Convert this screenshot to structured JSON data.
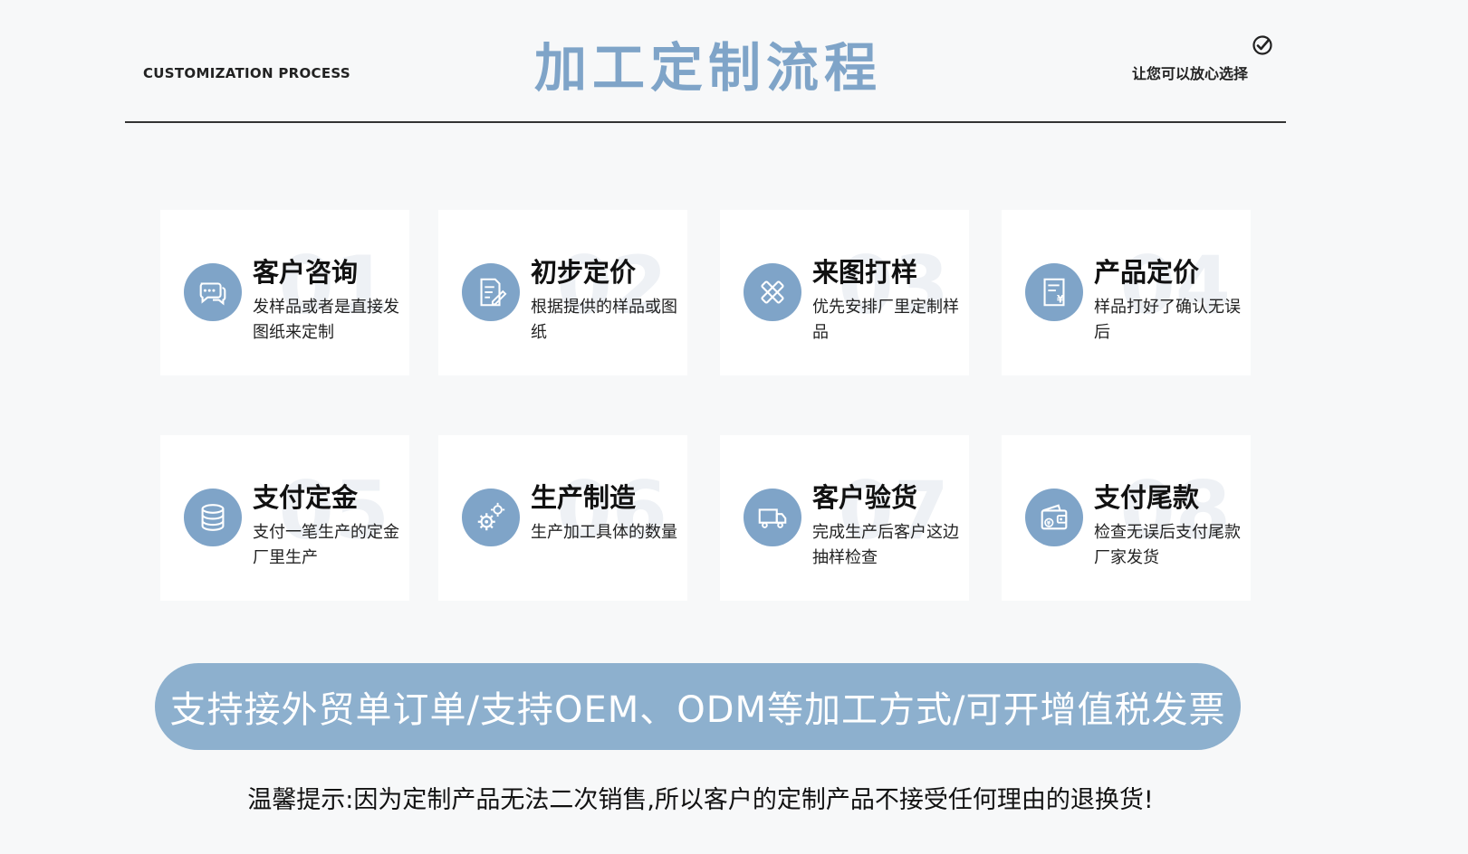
{
  "header": {
    "en_label": "CUSTOMIZATION PROCESS",
    "title": "加工定制流程",
    "tagline": "让您可以放心选择"
  },
  "steps": [
    {
      "number": "01",
      "title": "客户咨询",
      "desc": "发样品或者是直接发图纸来定制",
      "icon": "chat-bubbles-icon"
    },
    {
      "number": "02",
      "title": "初步定价",
      "desc": "根据提供的样品或图纸",
      "icon": "document-edit-icon"
    },
    {
      "number": "03",
      "title": "来图打样",
      "desc": "优先安排厂里定制样品",
      "icon": "pencil-ruler-icon"
    },
    {
      "number": "04",
      "title": "产品定价",
      "desc": "样品打好了确认无误后",
      "icon": "price-document-icon"
    },
    {
      "number": "05",
      "title": "支付定金",
      "desc": "支付一笔生产的定金厂里生产",
      "icon": "coin-stack-icon"
    },
    {
      "number": "06",
      "title": "生产制造",
      "desc": "生产加工具体的数量",
      "icon": "gears-icon"
    },
    {
      "number": "07",
      "title": "客户验货",
      "desc": "完成生产后客户这边抽样检查",
      "icon": "delivery-truck-icon"
    },
    {
      "number": "08",
      "title": "支付尾款",
      "desc": "检查无误后支付尾款厂家发货",
      "icon": "wallet-icon"
    }
  ],
  "banner": {
    "text": "支持接外贸单订单/支持OEM、ODM等加工方式/可开增值税发票"
  },
  "notice": {
    "text": "温馨提示:因为定制产品无法二次销售,所以客户的定制产品不接受任何理由的退换货!"
  },
  "colors": {
    "accent": "#7fa4c8",
    "banner": "#8db0ce",
    "background": "#f7f8f9"
  }
}
